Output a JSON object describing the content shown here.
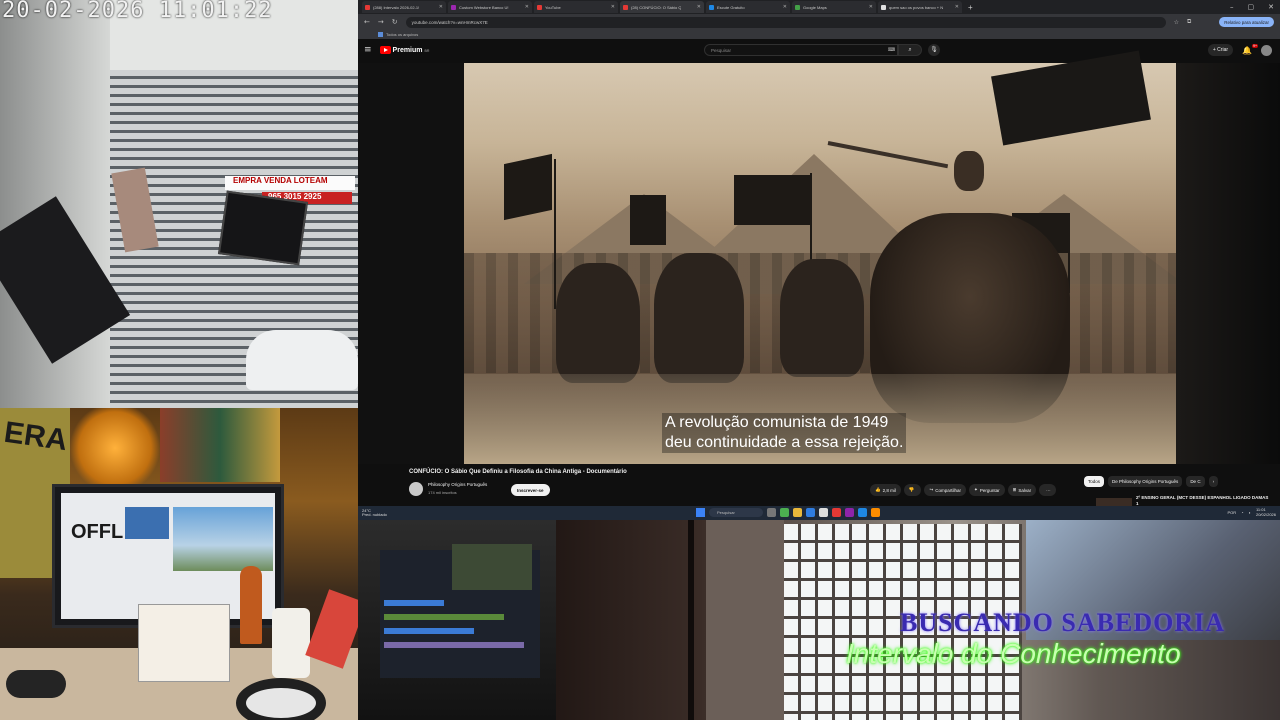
{
  "camera": {
    "timestamp": "20-02-2026 11:01:22",
    "gate_sign": "EMPRA  VENDA  LOTEAM",
    "gate_phone": "965 3015 2925"
  },
  "desk_monitor_text": "OFFL",
  "poster_text": "ERA",
  "overlay": {
    "title": "BUSCANDO SABEDORIA",
    "subtitle": "Intervalo do Conhecimento"
  },
  "browser": {
    "tabs": [
      {
        "label": "(288) Intervalo 2026-02-1!",
        "color": "#e53935"
      },
      {
        "label": "Custom Webstore Banco U!",
        "color": "#9c27b0"
      },
      {
        "label": "YouTube",
        "color": "#e53935"
      },
      {
        "label": "(28) CONFÚCIO: O Sábio Q",
        "color": "#e53935",
        "active": true
      },
      {
        "label": "Escute Gratuito",
        "color": "#1e88e5"
      },
      {
        "label": "Google Maps",
        "color": "#43a047"
      },
      {
        "label": "quem sao os povos banco + N",
        "color": "#e0e0e0"
      }
    ],
    "url": "youtube.com/watch?v=wnHmRcwX7E",
    "update_label": "Relativo para atualizar",
    "bookmark": "Todos os arquivos"
  },
  "youtube": {
    "brand": "Premium",
    "brand_region": "BR",
    "search_placeholder": "Pesquisar",
    "create_label": "+ Criar",
    "notif_count": "9+",
    "subtitles": [
      "A revolução comunista de 1949",
      "deu continuidade a essa rejeição."
    ],
    "video_title": "CONFÚCIO: O Sábio Que Definiu a Filosofia da China Antiga - Documentário",
    "channel": "Philosophy Origins Português",
    "channel_subs": "174 mil inscritos",
    "subscribe_label": "Inscrever-se",
    "actions": [
      {
        "label": "2,8 mil",
        "icon": "thumbs-up-icon"
      },
      {
        "label": "",
        "icon": "thumbs-down-icon"
      },
      {
        "label": "Compartilhar",
        "icon": "share-icon"
      },
      {
        "label": "Perguntar",
        "icon": "sparkle-icon"
      },
      {
        "label": "Salvar",
        "icon": "bookmark-icon"
      },
      {
        "label": "···",
        "icon": "more-icon"
      }
    ],
    "chips": [
      {
        "label": "Todos",
        "selected": true
      },
      {
        "label": "De Philosophy Origins Português",
        "selected": false
      },
      {
        "label": "De C",
        "selected": false
      }
    ],
    "rec_title": "2º ENSINO GERAL (MCT DESSE) ESPANHOL LIGADO DAMAS 1"
  },
  "taskbar": {
    "weather_temp": "24°C",
    "weather_desc": "Pred. nublado",
    "search_placeholder": "Pesquisar",
    "lang": "POR",
    "time": "11:01",
    "date": "20/02/2026"
  }
}
